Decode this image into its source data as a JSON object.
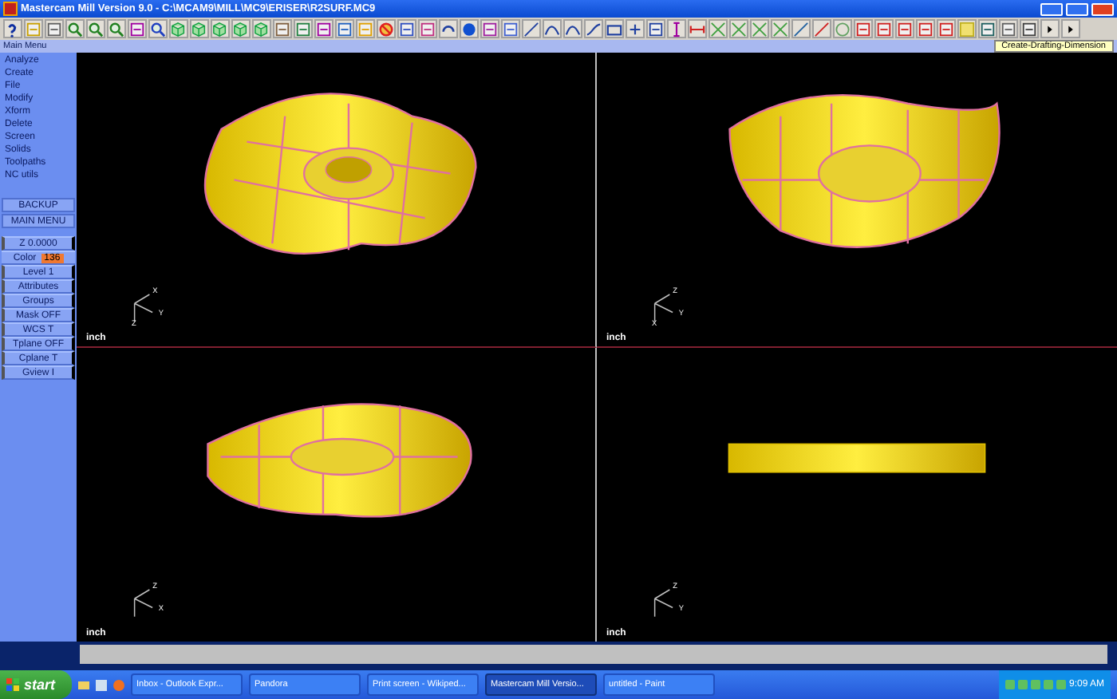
{
  "window": {
    "title": "Mastercam Mill Version 9.0 - C:\\MCAM9\\MILL\\MC9\\ERISER\\R2SURF.MC9"
  },
  "tooltip": "Create-Drafting-Dimension",
  "menu_title": "Main Menu",
  "menu_items": [
    "Analyze",
    "Create",
    "File",
    "Modify",
    "Xform",
    "Delete",
    "Screen",
    "Solids",
    "Toolpaths",
    "NC utils"
  ],
  "nav_buttons": [
    "BACKUP",
    "MAIN MENU"
  ],
  "status": [
    {
      "kind": "value",
      "label": "Z",
      "value": "0.0000"
    },
    {
      "kind": "color",
      "label": "Color",
      "value": "136",
      "color": "#f07830"
    },
    {
      "kind": "value",
      "label": "Level",
      "value": "1"
    },
    {
      "kind": "button",
      "label": "Attributes"
    },
    {
      "kind": "button",
      "label": "Groups"
    },
    {
      "kind": "value",
      "label": "Mask",
      "value": "OFF"
    },
    {
      "kind": "value",
      "label": "WCS",
      "value": "T"
    },
    {
      "kind": "value",
      "label": "Tplane",
      "value": "OFF"
    },
    {
      "kind": "value",
      "label": "Cplane",
      "value": "T"
    },
    {
      "kind": "value",
      "label": "Gview",
      "value": "I"
    }
  ],
  "viewports": [
    {
      "kind": "iso",
      "unit": "inch",
      "axes": [
        "X",
        "Y",
        "Z"
      ]
    },
    {
      "kind": "top",
      "unit": "inch",
      "axes": [
        "Z",
        "Y",
        "X"
      ]
    },
    {
      "kind": "front",
      "unit": "inch",
      "axes": [
        "Z",
        "X"
      ]
    },
    {
      "kind": "side",
      "unit": "inch",
      "axes": [
        "Z",
        "Y"
      ]
    }
  ],
  "taskbar": {
    "start": "start",
    "tasks": [
      {
        "label": "Inbox - Outlook Expr...",
        "selected": false
      },
      {
        "label": "Pandora",
        "selected": false
      },
      {
        "label": "Print screen - Wikiped...",
        "selected": false
      },
      {
        "label": "Mastercam Mill Versio...",
        "selected": true
      },
      {
        "label": "untitled - Paint",
        "selected": false
      }
    ],
    "clock": "9:09 AM"
  }
}
